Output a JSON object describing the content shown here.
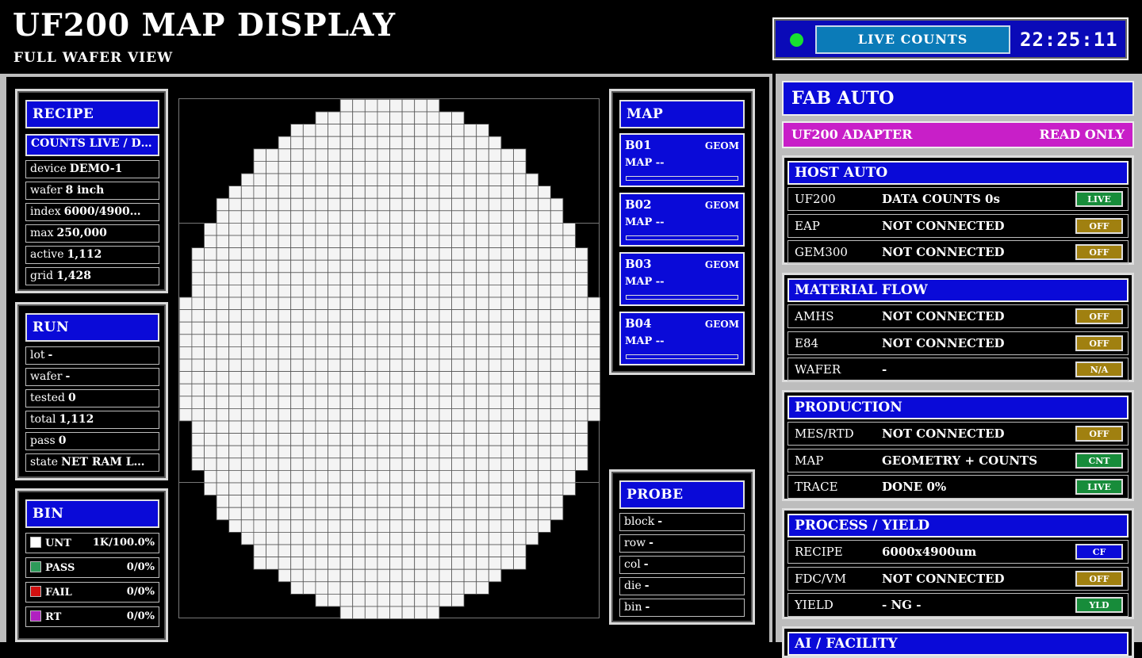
{
  "header": {
    "title": "UF200 MAP DISPLAY",
    "subtitle": "FULL WAFER VIEW",
    "live_label": "LIVE COUNTS",
    "clock": "22:25:11",
    "led_color": "#18e030"
  },
  "recipe": {
    "title": "RECIPE",
    "selector": "COUNTS LIVE / D…",
    "rows": [
      {
        "k": "device",
        "v": "DEMO-1"
      },
      {
        "k": "wafer",
        "v": "8 inch"
      },
      {
        "k": "index",
        "v": "6000/4900…"
      },
      {
        "k": "max",
        "v": "250,000"
      },
      {
        "k": "active",
        "v": "1,112"
      },
      {
        "k": "grid",
        "v": "1,428"
      }
    ]
  },
  "run": {
    "title": "RUN",
    "rows": [
      {
        "k": "lot",
        "v": "-"
      },
      {
        "k": "wafer",
        "v": "-"
      },
      {
        "k": "tested",
        "v": "0"
      },
      {
        "k": "total",
        "v": "1,112"
      },
      {
        "k": "pass",
        "v": "0"
      },
      {
        "k": "state",
        "v": "NET RAM L…"
      }
    ]
  },
  "bin": {
    "title": "BIN",
    "rows": [
      {
        "k": "UNT",
        "v": "1K/100.0%",
        "color": "#ffffff"
      },
      {
        "k": "PASS",
        "v": "0/0%",
        "color": "#2e9a5a"
      },
      {
        "k": "FAIL",
        "v": "0/0%",
        "color": "#d01010"
      },
      {
        "k": "RT",
        "v": "0/0%",
        "color": "#b020c0"
      }
    ]
  },
  "map": {
    "title": "MAP",
    "cards": [
      {
        "id": "B01",
        "tag": "GEOM",
        "line": "MAP --"
      },
      {
        "id": "B02",
        "tag": "GEOM",
        "line": "MAP --"
      },
      {
        "id": "B03",
        "tag": "GEOM",
        "line": "MAP --"
      },
      {
        "id": "B04",
        "tag": "GEOM",
        "line": "MAP --"
      }
    ]
  },
  "probe": {
    "title": "PROBE",
    "rows": [
      {
        "k": "block",
        "v": "-"
      },
      {
        "k": "row",
        "v": "-"
      },
      {
        "k": "col",
        "v": "-"
      },
      {
        "k": "die",
        "v": "-"
      },
      {
        "k": "bin",
        "v": "-"
      }
    ]
  },
  "fab": {
    "title": "FAB AUTO",
    "adapter": "UF200 ADAPTER",
    "adapter_mode": "READ ONLY"
  },
  "host": {
    "title": "HOST AUTO",
    "rows": [
      {
        "k": "UF200",
        "v": "DATA COUNTS 0s",
        "tag": "LIVE",
        "cls": "t-live"
      },
      {
        "k": "EAP",
        "v": "NOT CONNECTED",
        "tag": "OFF",
        "cls": "t-off"
      },
      {
        "k": "GEM300",
        "v": "NOT CONNECTED",
        "tag": "OFF",
        "cls": "t-off"
      }
    ]
  },
  "material": {
    "title": "MATERIAL FLOW",
    "rows": [
      {
        "k": "AMHS",
        "v": "NOT CONNECTED",
        "tag": "OFF",
        "cls": "t-off"
      },
      {
        "k": "E84",
        "v": "NOT CONNECTED",
        "tag": "OFF",
        "cls": "t-off"
      },
      {
        "k": "WAFER",
        "v": "-",
        "tag": "N/A",
        "cls": "t-off"
      }
    ]
  },
  "production": {
    "title": "PRODUCTION",
    "rows": [
      {
        "k": "MES/RTD",
        "v": "NOT CONNECTED",
        "tag": "OFF",
        "cls": "t-off"
      },
      {
        "k": "MAP",
        "v": "GEOMETRY + COUNTS",
        "tag": "CNT",
        "cls": "t-live"
      },
      {
        "k": "TRACE",
        "v": "DONE 0%",
        "tag": "LIVE",
        "cls": "t-live"
      }
    ]
  },
  "process": {
    "title": "PROCESS / YIELD",
    "rows": [
      {
        "k": "RECIPE",
        "v": "6000x4900um",
        "tag": "CF",
        "cls": "t-cf"
      },
      {
        "k": "FDC/VM",
        "v": "NOT CONNECTED",
        "tag": "OFF",
        "cls": "t-off"
      },
      {
        "k": "YIELD",
        "v": "- NG -",
        "tag": "YLD",
        "cls": "t-live"
      }
    ]
  },
  "ai": {
    "title": "AI / FACILITY"
  }
}
